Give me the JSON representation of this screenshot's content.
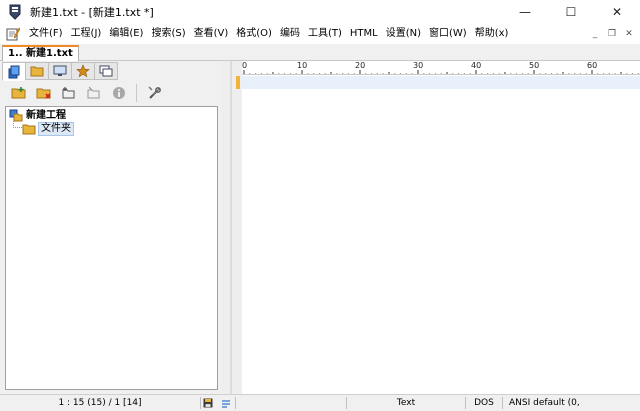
{
  "window": {
    "title": "新建1.txt - [新建1.txt *]",
    "controls": {
      "minimize": "—",
      "maximize": "☐",
      "close": "✕"
    }
  },
  "menu": {
    "items": [
      "文件(F)",
      "工程(J)",
      "编辑(E)",
      "搜索(S)",
      "查看(V)",
      "格式(O)",
      "编码",
      "工具(T)",
      "HTML",
      "设置(N)",
      "窗口(W)",
      "帮助(x)"
    ],
    "mdi_controls": {
      "minimize": "_",
      "restore": "❐",
      "close": "✕"
    }
  },
  "document_tab": {
    "label": "1.. 新建1.txt"
  },
  "left_pane": {
    "tree": {
      "root": "新建工程",
      "child": "文件夹"
    }
  },
  "ruler": {
    "labels": [
      "0",
      "10",
      "20",
      "30",
      "40",
      "50",
      "60"
    ]
  },
  "status_bar": {
    "position": "1 : 15 (15) / 1  [14]",
    "mode": "Text",
    "line_ending": "DOS",
    "encoding": "ANSI default (0,"
  },
  "colors": {
    "accent_tab": "#f08a24",
    "current_line": "#e8f1fb",
    "folder": "#e8b43c"
  }
}
